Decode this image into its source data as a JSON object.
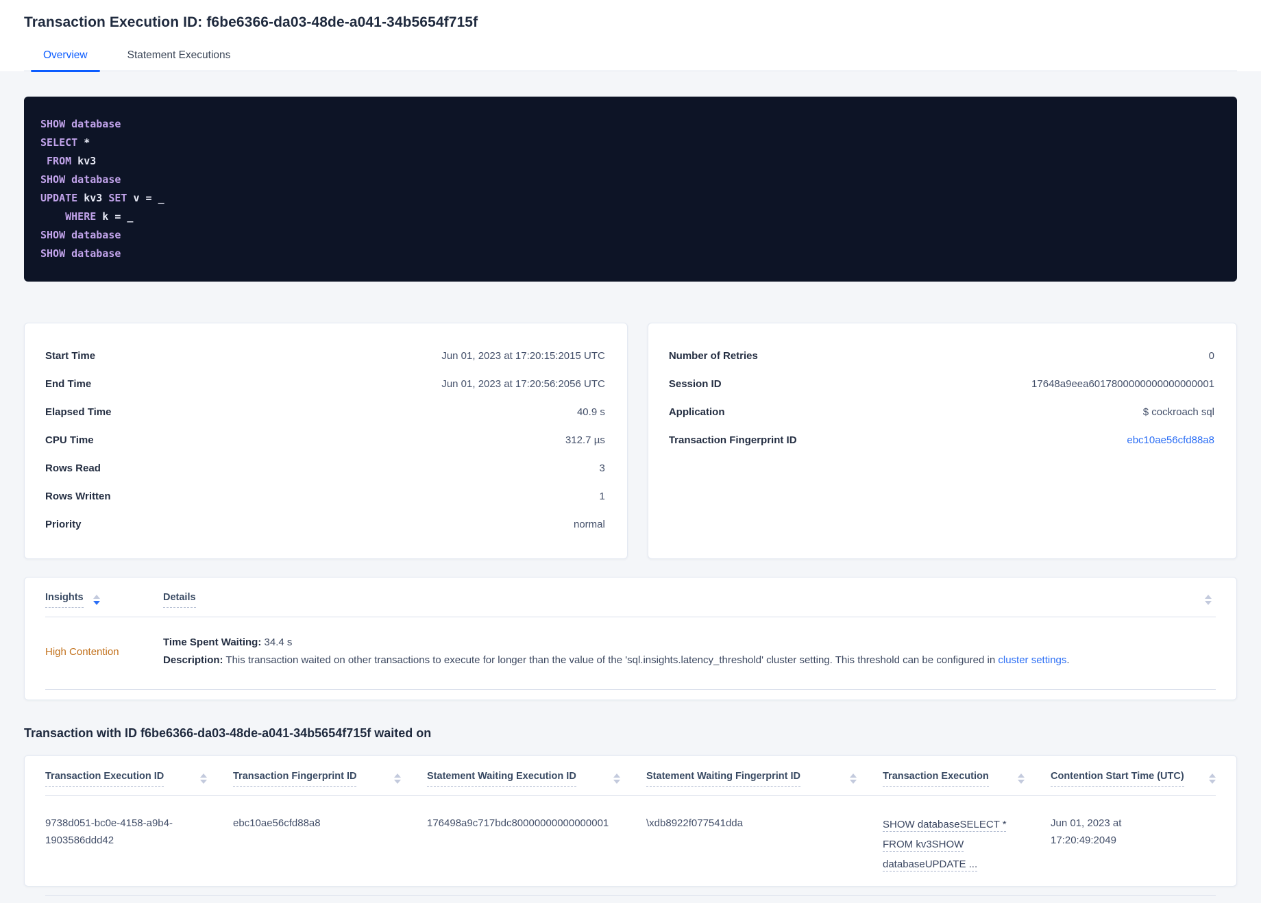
{
  "page": {
    "title": "Transaction Execution ID: f6be6366-da03-48de-a041-34b5654f715f"
  },
  "tabs": [
    {
      "label": "Overview",
      "active": true
    },
    {
      "label": "Statement Executions",
      "active": false
    }
  ],
  "colors": {
    "accent_blue": "#0b5cff",
    "link_blue": "#2b6ef5",
    "warning_orange": "#c2711c",
    "code_background": "#0d1426",
    "code_keyword": "#c1a3ea"
  },
  "sql_box": {
    "lines": [
      [
        {
          "t": "SHOW",
          "k": true
        },
        {
          "t": " ",
          "k": false
        },
        {
          "t": "database",
          "k": true
        }
      ],
      [
        {
          "t": "SELECT",
          "k": true
        },
        {
          "t": " *",
          "k": false
        }
      ],
      [
        {
          "t": " ",
          "k": false
        },
        {
          "t": "FROM",
          "k": true
        },
        {
          "t": " kv3",
          "k": false
        }
      ],
      [
        {
          "t": "SHOW",
          "k": true
        },
        {
          "t": " ",
          "k": false
        },
        {
          "t": "database",
          "k": true
        }
      ],
      [
        {
          "t": "UPDATE",
          "k": true
        },
        {
          "t": " kv3 ",
          "k": false
        },
        {
          "t": "SET",
          "k": true
        },
        {
          "t": " v = _",
          "k": false
        }
      ],
      [
        {
          "t": "    ",
          "k": false
        },
        {
          "t": "WHERE",
          "k": true
        },
        {
          "t": " k = _",
          "k": false
        }
      ],
      [
        {
          "t": "SHOW",
          "k": true
        },
        {
          "t": " ",
          "k": false
        },
        {
          "t": "database",
          "k": true
        }
      ],
      [
        {
          "t": "SHOW",
          "k": true
        },
        {
          "t": " ",
          "k": false
        },
        {
          "t": "database",
          "k": true
        }
      ]
    ]
  },
  "summary_left": {
    "rows": [
      {
        "label": "Start Time",
        "value": "Jun 01, 2023 at 17:20:15:2015 UTC"
      },
      {
        "label": "End Time",
        "value": "Jun 01, 2023 at 17:20:56:2056 UTC"
      },
      {
        "label": "Elapsed Time",
        "value": "40.9 s"
      },
      {
        "label": "CPU Time",
        "value": "312.7 µs"
      },
      {
        "label": "Rows Read",
        "value": "3"
      },
      {
        "label": "Rows Written",
        "value": "1"
      },
      {
        "label": "Priority",
        "value": "normal"
      }
    ]
  },
  "summary_right": {
    "rows": [
      {
        "label": "Number of Retries",
        "value": "0"
      },
      {
        "label": "Session ID",
        "value": "17648a9eea6017800000000000000001"
      },
      {
        "label": "Application",
        "value": "$ cockroach sql"
      },
      {
        "label": "Transaction Fingerprint ID",
        "value": "ebc10ae56cfd88a8"
      }
    ]
  },
  "insights_table": {
    "col_insights": "Insights",
    "col_details": "Details",
    "row": {
      "insight": "High Contention",
      "waiting_label": "Time Spent Waiting:",
      "waiting_value": " 34.4 s",
      "desc_label": "Description:",
      "desc_text": " This transaction waited on other transactions to execute for longer than the value of the 'sql.insights.latency_threshold' cluster setting. This threshold can be configured in ",
      "desc_link": "cluster settings",
      "desc_period": "."
    }
  },
  "waited_on": {
    "heading": "Transaction with ID f6be6366-da03-48de-a041-34b5654f715f waited on",
    "headers": [
      "Transaction Execution ID",
      "Transaction Fingerprint ID",
      "Statement Waiting Execution ID",
      "Statement Waiting Fingerprint ID",
      "Transaction Execution",
      "Contention Start Time (UTC)"
    ],
    "row": {
      "transaction_execution_id": "9738d051-bc0e-4158-a9b4-1903586ddd42",
      "transaction_fingerprint_id": "ebc10ae56cfd88a8",
      "statement_waiting_execution_id": "176498a9c717bdc80000000000000001",
      "statement_waiting_fingerprint_id": "\\xdb8922f077541dda",
      "transaction_execution": "SHOW databaseSELECT * FROM kv3SHOW databaseUPDATE ...",
      "contention_start_time": "Jun 01, 2023 at 17:20:49:2049"
    }
  }
}
